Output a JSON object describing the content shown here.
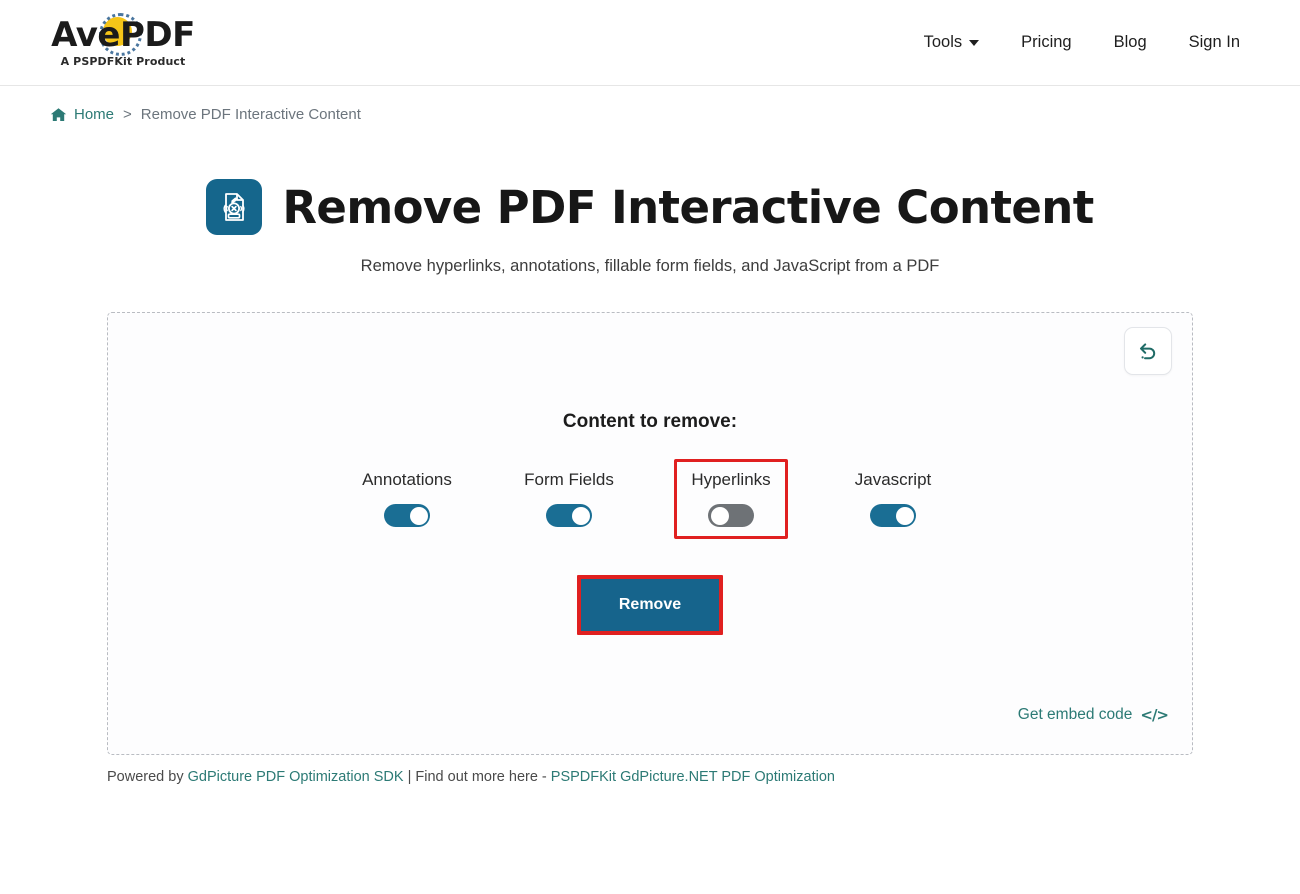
{
  "header": {
    "logo": {
      "part1": "Av",
      "part2": "e",
      "part3": "PDF",
      "tagline": "A PSPDFKit Product"
    },
    "nav": [
      {
        "label": "Tools",
        "has_caret": true
      },
      {
        "label": "Pricing",
        "has_caret": false
      },
      {
        "label": "Blog",
        "has_caret": false
      },
      {
        "label": "Sign In",
        "has_caret": false
      }
    ]
  },
  "breadcrumb": {
    "home_label": "Home",
    "separator": ">",
    "current": "Remove PDF Interactive Content"
  },
  "hero": {
    "title": "Remove PDF Interactive Content",
    "subtitle": "Remove hyperlinks, annotations, fillable form fields, and JavaScript from a PDF",
    "icon": "remove-interactive-content-icon"
  },
  "panel": {
    "reset_icon": "undo-reset-icon",
    "heading": "Content to remove:",
    "toggles": [
      {
        "label": "Annotations",
        "state": "on",
        "highlighted": false
      },
      {
        "label": "Form Fields",
        "state": "on",
        "highlighted": false
      },
      {
        "label": "Hyperlinks",
        "state": "off",
        "highlighted": true
      },
      {
        "label": "Javascript",
        "state": "on",
        "highlighted": false
      }
    ],
    "remove_button": "Remove",
    "embed": {
      "label": "Get embed code",
      "glyph": "</>"
    }
  },
  "footer": {
    "prefix": "Powered by ",
    "link1": "GdPicture PDF Optimization SDK",
    "middle": " | Find out more here - ",
    "link2": "PSPDFKit GdPicture.NET PDF Optimization"
  },
  "colors": {
    "brand_teal": "#2c7a75",
    "accent_blue": "#16648c",
    "toggle_on": "#1a6e94",
    "toggle_off": "#6e7276",
    "highlight_red": "#e02020",
    "logo_yellow": "#f5c518"
  }
}
